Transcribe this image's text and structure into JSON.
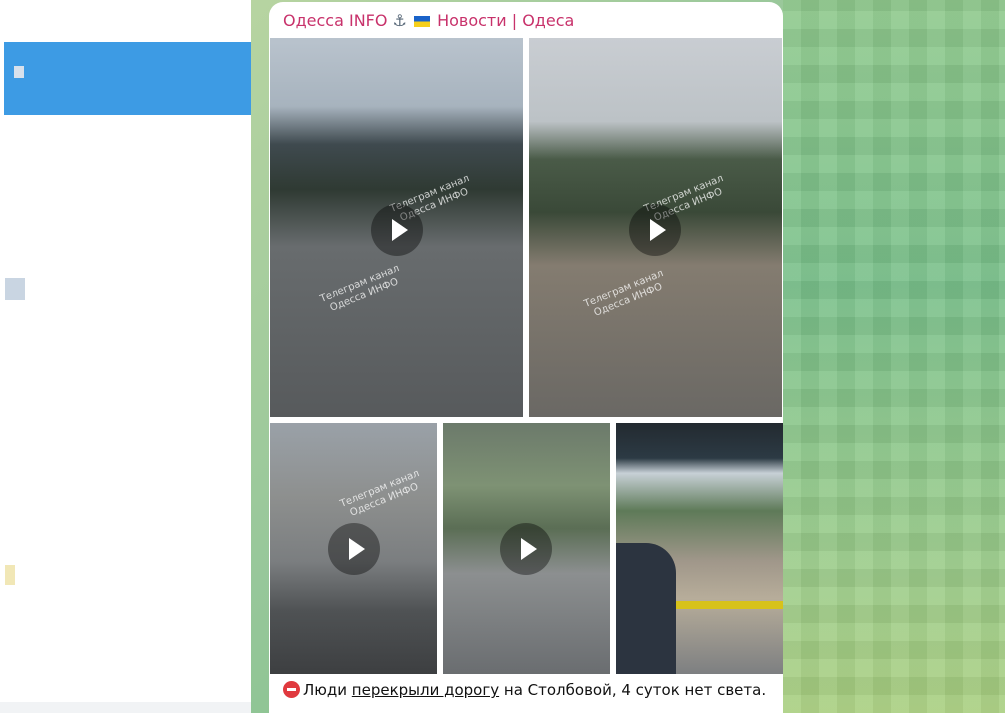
{
  "sidebar": {
    "active_chat_color": "#3d9be4"
  },
  "post": {
    "channel_name": "Одесса INFO",
    "channel_name_suffix": "Новости | Одеса",
    "channel_color": "#c8326b",
    "watermark_line1": "Телеграм канал",
    "watermark_line2": "Одесса ИНФО",
    "caption_before": "Люди ",
    "caption_link": "перекрыли дорогу",
    "caption_after": " на Столбовой, 4 суток нет света.",
    "media": [
      {
        "kind": "video"
      },
      {
        "kind": "video"
      },
      {
        "kind": "video"
      },
      {
        "kind": "video"
      },
      {
        "kind": "image"
      }
    ]
  },
  "icons": {
    "anchor": "anchor-icon",
    "flag": "ukraine-flag-icon",
    "stop": "no-entry-emoji-icon",
    "play": "play-icon"
  }
}
